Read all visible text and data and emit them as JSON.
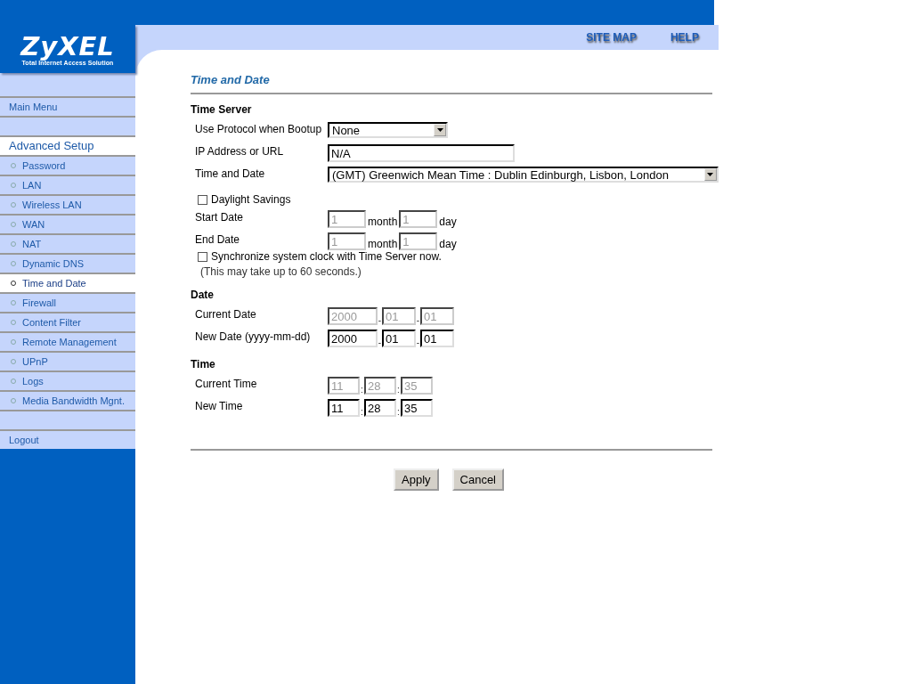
{
  "header": {
    "logo": {
      "brand": "ZyXEL",
      "tagline": "Total Internet Access Solution"
    },
    "links": [
      {
        "label": "SITE MAP"
      },
      {
        "label": "HELP"
      }
    ]
  },
  "sidebar": {
    "items": [
      {
        "kind": "link",
        "label": "Main Menu",
        "selected": false
      },
      {
        "kind": "spacer"
      },
      {
        "kind": "section",
        "label": "Advanced Setup",
        "selected": false
      },
      {
        "kind": "item",
        "label": "Password",
        "selected": false
      },
      {
        "kind": "item",
        "label": "LAN",
        "selected": false
      },
      {
        "kind": "item",
        "label": "Wireless LAN",
        "selected": false
      },
      {
        "kind": "item",
        "label": "WAN",
        "selected": false
      },
      {
        "kind": "item",
        "label": "NAT",
        "selected": false
      },
      {
        "kind": "item",
        "label": "Dynamic DNS",
        "selected": false
      },
      {
        "kind": "item",
        "label": "Time and Date",
        "selected": true
      },
      {
        "kind": "item",
        "label": "Firewall",
        "selected": false
      },
      {
        "kind": "item",
        "label": "Content Filter",
        "selected": false
      },
      {
        "kind": "item",
        "label": "Remote Management",
        "selected": false
      },
      {
        "kind": "item",
        "label": "UPnP",
        "selected": false
      },
      {
        "kind": "item",
        "label": "Logs",
        "selected": false
      },
      {
        "kind": "item",
        "label": "Media Bandwidth Mgnt.",
        "selected": false
      },
      {
        "kind": "spacer"
      },
      {
        "kind": "link",
        "label": "Logout",
        "selected": false
      }
    ]
  },
  "page_title": "Time and Date",
  "sections": [
    {
      "heading": "Time Server",
      "rows": [
        {
          "kind": "select",
          "label": "Use Protocol when Bootup",
          "value": "None"
        },
        {
          "kind": "text",
          "label": "IP Address or URL",
          "value": "N/A"
        },
        {
          "kind": "select",
          "label": "Time and Date",
          "value": "(GMT) Greenwich Mean Time : Dublin Edinburgh, Lisbon, London"
        },
        {
          "kind": "checkbox",
          "label": "Daylight Savings",
          "checked": false
        },
        {
          "kind": "range",
          "label": "Start Date",
          "parts": [
            {
              "value": "1",
              "unit": "month",
              "disabled": true
            },
            {
              "value": "1",
              "unit": "day",
              "disabled": true
            }
          ]
        },
        {
          "kind": "range",
          "label": "End Date",
          "parts": [
            {
              "value": "1",
              "unit": "month",
              "disabled": true
            },
            {
              "value": "1",
              "unit": "day",
              "disabled": true
            }
          ]
        },
        {
          "kind": "checkbox",
          "label": "Synchronize system clock with Time Server now.",
          "checked": false,
          "note": "(This may take up to 60 seconds.)"
        }
      ]
    },
    {
      "heading": "Date",
      "rows": [
        {
          "kind": "date",
          "label": "Current Date",
          "separator": "-",
          "parts": [
            {
              "value": "2000",
              "disabled": true
            },
            {
              "value": "01",
              "disabled": true
            },
            {
              "value": "01",
              "disabled": true
            }
          ]
        },
        {
          "kind": "date",
          "label": "New Date (yyyy-mm-dd)",
          "separator": "-",
          "parts": [
            {
              "value": "2000",
              "disabled": false
            },
            {
              "value": "01",
              "disabled": false
            },
            {
              "value": "01",
              "disabled": false
            }
          ]
        }
      ]
    },
    {
      "heading": "Time",
      "rows": [
        {
          "kind": "time",
          "label": "Current Time",
          "separator": ":",
          "parts": [
            {
              "value": "11",
              "disabled": true
            },
            {
              "value": "28",
              "disabled": true
            },
            {
              "value": "35",
              "disabled": true
            }
          ]
        },
        {
          "kind": "time",
          "label": "New Time",
          "separator": ":",
          "parts": [
            {
              "value": "11",
              "disabled": false
            },
            {
              "value": "28",
              "disabled": false
            },
            {
              "value": "35",
              "disabled": false
            }
          ]
        }
      ]
    }
  ],
  "buttons": [
    {
      "label": "Apply"
    },
    {
      "label": "Cancel"
    }
  ]
}
